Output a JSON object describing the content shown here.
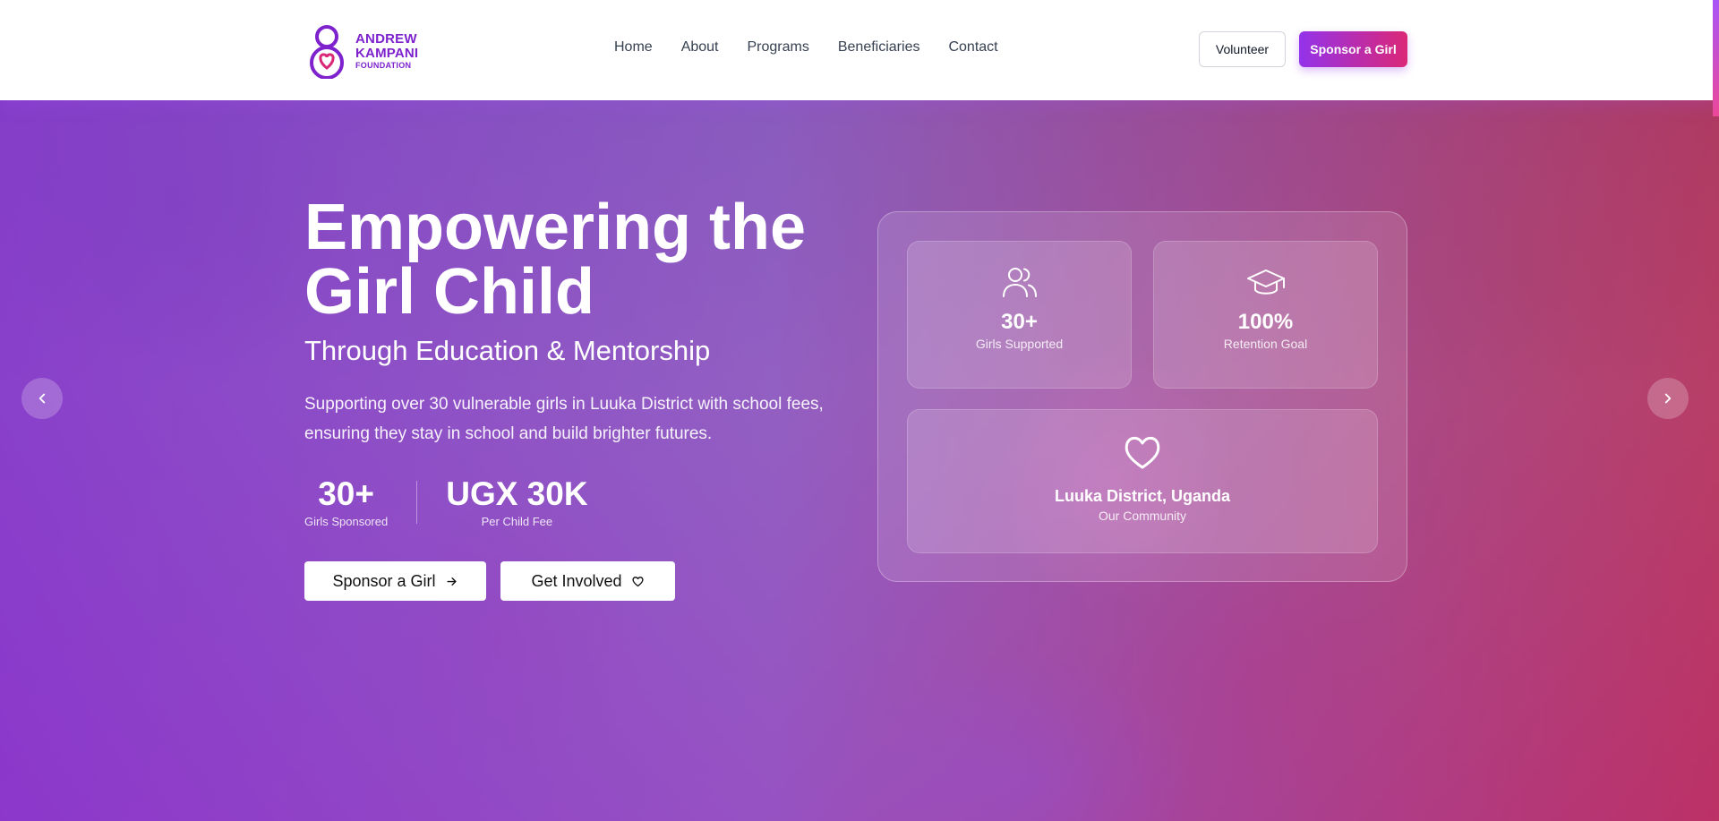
{
  "logo": {
    "line1": "ANDREW",
    "line2": "KAMPANI",
    "line3": "FOUNDATION"
  },
  "nav": {
    "items": [
      "Home",
      "About",
      "Programs",
      "Beneficiaries",
      "Contact"
    ]
  },
  "header_buttons": {
    "volunteer": "Volunteer",
    "sponsor": "Sponsor a Girl"
  },
  "colors": {
    "brand_purple": "#9333ea",
    "brand_pink": "#db2777",
    "nav_text": "#374151"
  },
  "hero": {
    "title_line1": "Empowering the",
    "title_line2": "Girl Child",
    "subtitle": "Through Education & Mentorship",
    "description": "Supporting over 30 vulnerable girls in Luuka District with school fees, ensuring they stay in school and build brighter futures.",
    "stats": [
      {
        "value": "30+",
        "label": "Girls Sponsored"
      },
      {
        "value": "UGX 30K",
        "label": "Per Child Fee"
      }
    ],
    "buttons": {
      "primary": "Sponsor a Girl",
      "secondary": "Get Involved"
    },
    "icons": {
      "prev": "chevron-left-icon",
      "next": "chevron-right-icon",
      "primary_btn": "arrow-right-icon",
      "secondary_btn": "heart-icon"
    }
  },
  "cards": {
    "girls": {
      "value": "30+",
      "label": "Girls Supported",
      "icon": "users-icon"
    },
    "retention": {
      "value": "100%",
      "label": "Retention Goal",
      "icon": "graduation-cap-icon"
    },
    "community": {
      "title": "Luuka District, Uganda",
      "label": "Our Community",
      "icon": "heart-icon"
    }
  }
}
